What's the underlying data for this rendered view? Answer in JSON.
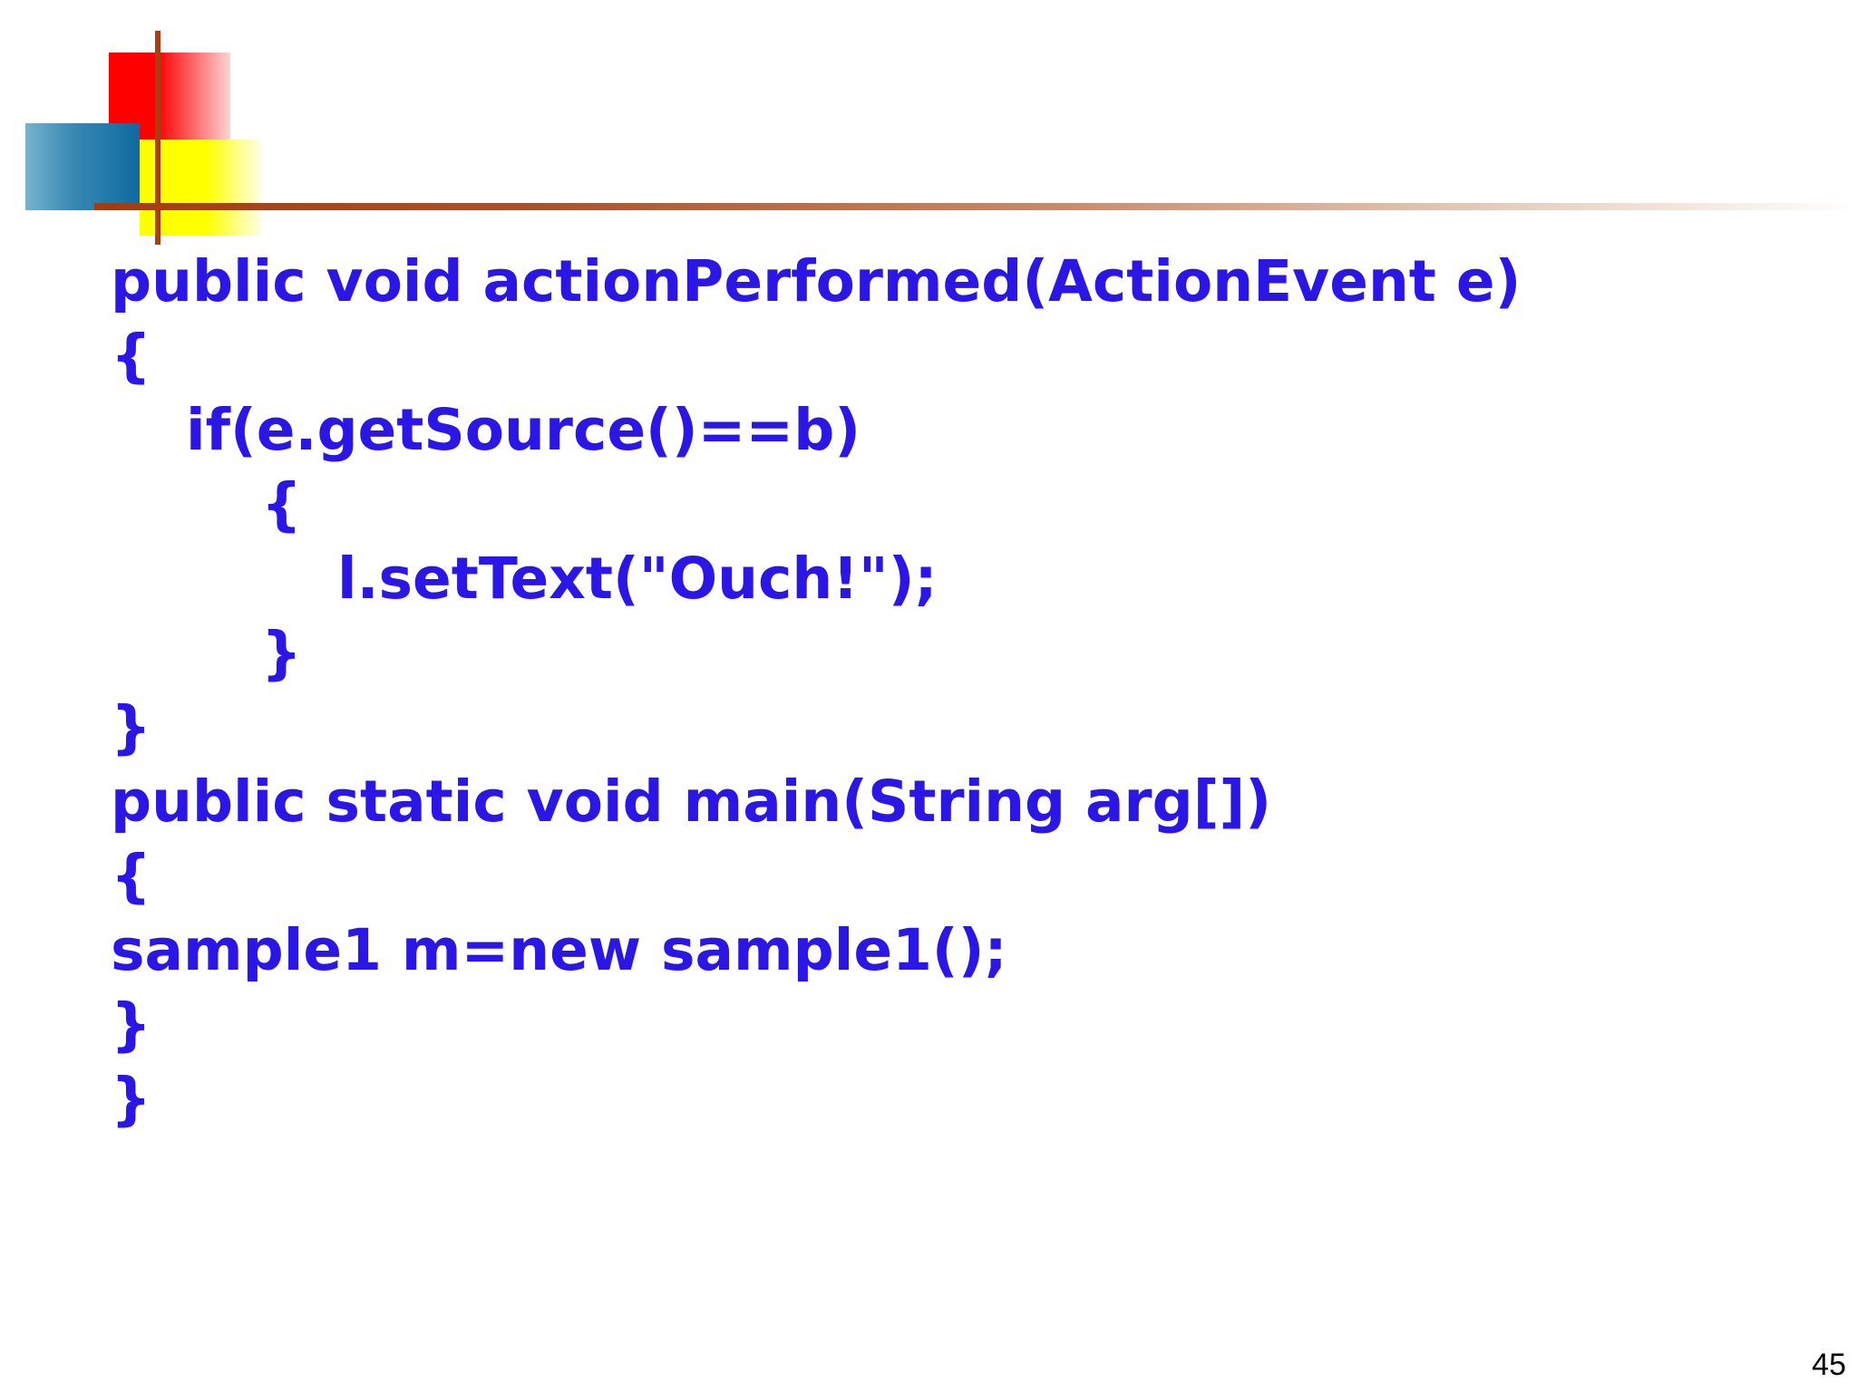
{
  "slide": {
    "number": "45",
    "text_color": "#2a16e6",
    "decoration_colors": {
      "red": "#ff0000",
      "yellow": "#ffff00",
      "blue": "#0f6aa0",
      "rule": "#a33c10"
    }
  },
  "code": {
    "lines": [
      "public void actionPerformed(ActionEvent e)",
      "{",
      "if(e.getSource()==b)",
      "{",
      "l.setText(\"Ouch!\");",
      "}",
      "}",
      "public static void main(String arg[])",
      "{",
      "sample1 m=new sample1();",
      "}",
      "}"
    ]
  }
}
